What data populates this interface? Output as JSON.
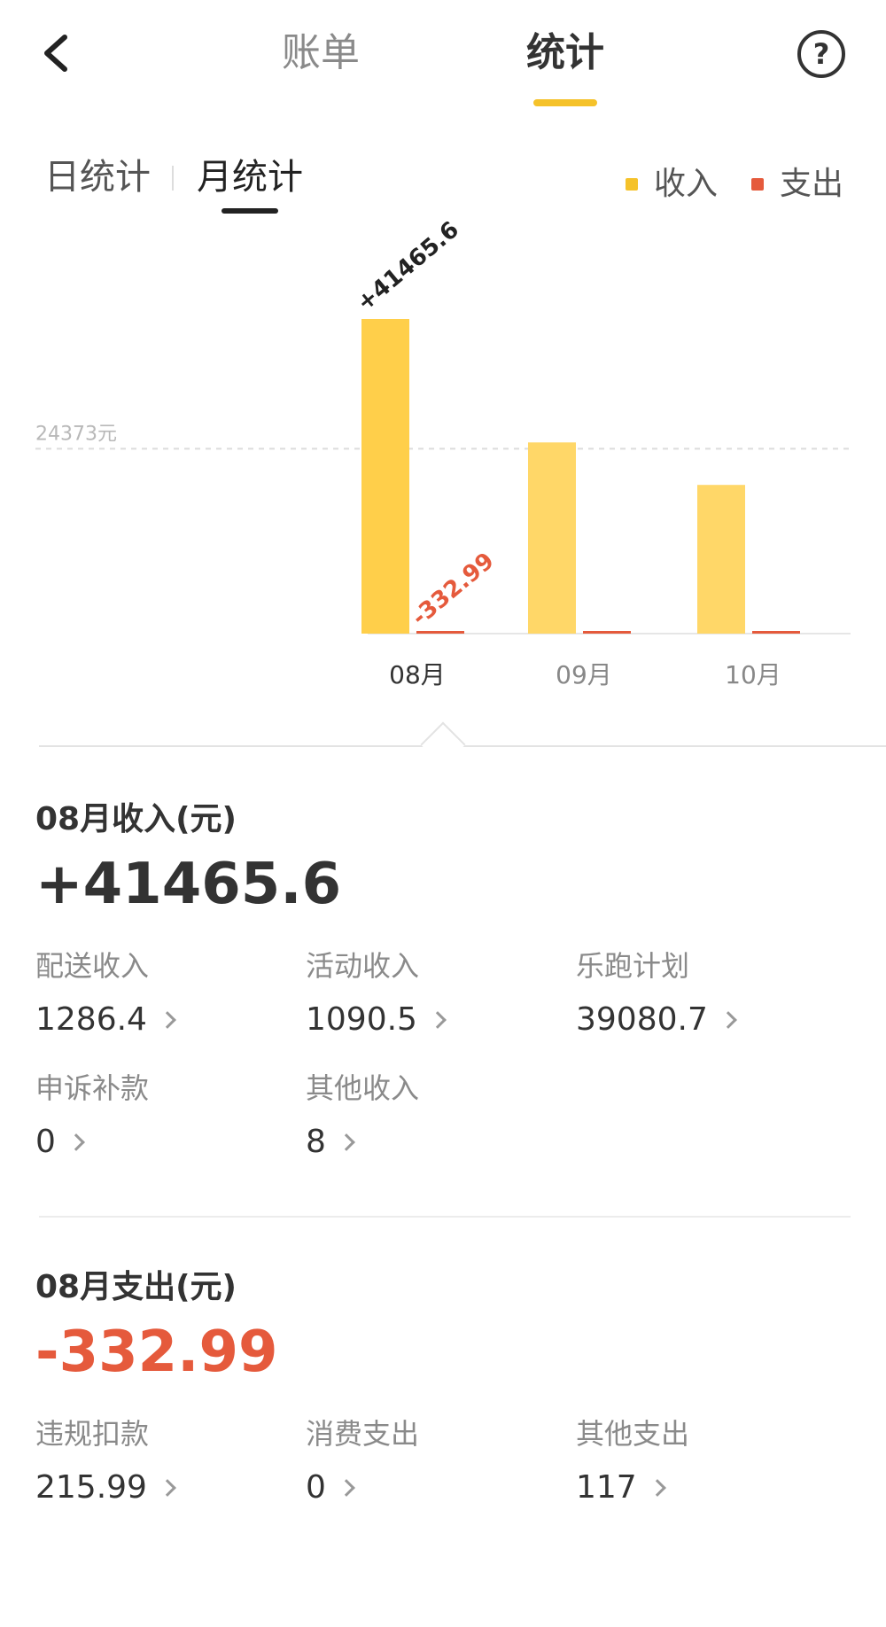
{
  "header": {
    "back_icon": "chevron-left-icon",
    "tabs": [
      {
        "label": "账单",
        "active": false
      },
      {
        "label": "统计",
        "active": true
      }
    ],
    "help_icon": "question-circle-icon",
    "help_glyph": "?",
    "accent_color": "#f5c22a"
  },
  "sub_tabs": {
    "day_label": "日统计",
    "month_label": "月统计",
    "active": "月统计"
  },
  "legend": {
    "income_label": "收入",
    "expense_label": "支出",
    "income_color": "#f5c22a",
    "expense_color": "#e55a3c"
  },
  "chart_data": {
    "type": "bar",
    "categories": [
      "08月",
      "09月",
      "10月"
    ],
    "selected_category": "08月",
    "reference_line": {
      "value": 24373,
      "label": "24373元"
    },
    "series": [
      {
        "name": "收入",
        "color": "#f5c22a",
        "values": [
          41465.6,
          25200,
          19600
        ]
      },
      {
        "name": "支出",
        "color": "#e55a3c",
        "values": [
          332.99,
          180,
          250
        ]
      }
    ],
    "data_labels": {
      "income": "+41465.6",
      "expense": "-332.99"
    },
    "ylim": [
      0,
      41465.6
    ]
  },
  "income_section": {
    "title": "08月收入(元)",
    "total": "+41465.6",
    "items": [
      {
        "label": "配送收入",
        "value": "1286.4"
      },
      {
        "label": "活动收入",
        "value": "1090.5"
      },
      {
        "label": "乐跑计划",
        "value": "39080.7"
      },
      {
        "label": "申诉补款",
        "value": "0"
      },
      {
        "label": "其他收入",
        "value": "8"
      }
    ]
  },
  "expense_section": {
    "title": "08月支出(元)",
    "total": "-332.99",
    "items": [
      {
        "label": "违规扣款",
        "value": "215.99"
      },
      {
        "label": "消费支出",
        "value": "0"
      },
      {
        "label": "其他支出",
        "value": "117"
      }
    ]
  }
}
